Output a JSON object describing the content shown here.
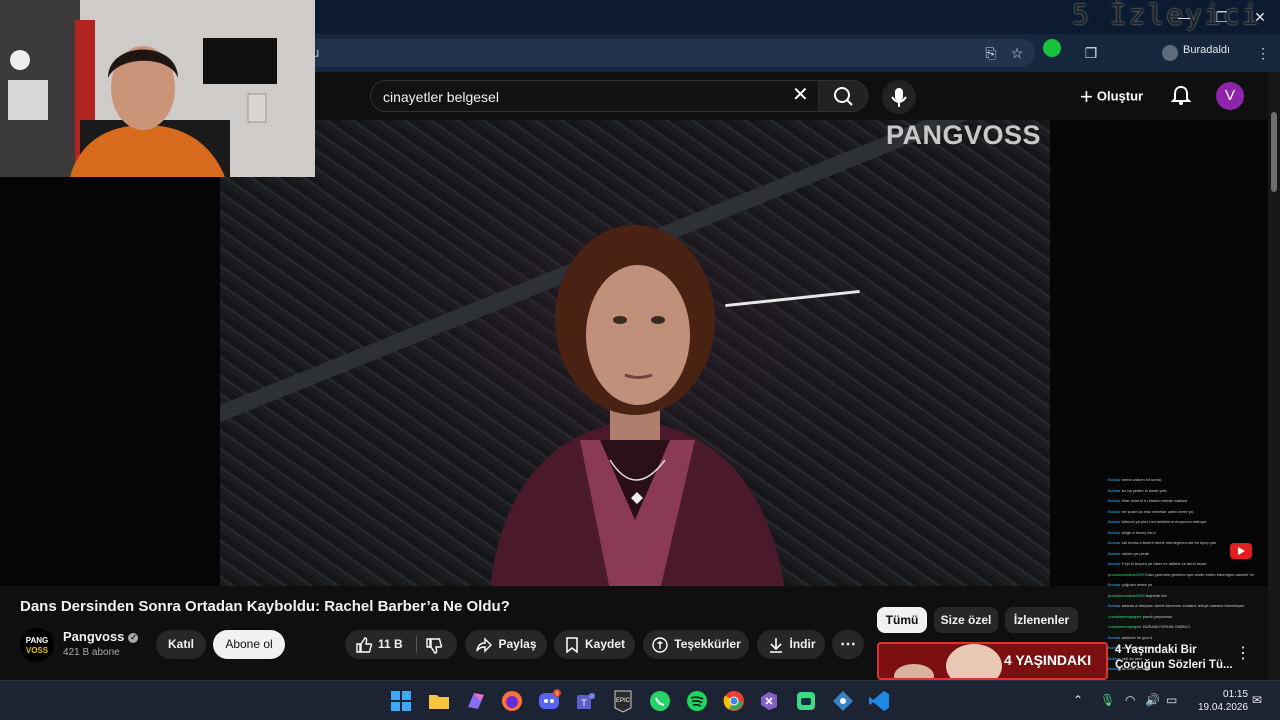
{
  "browser": {
    "address_text": "u",
    "profile_label": "Buradaldı",
    "viewer_overlay": "5 İzleyici",
    "window_controls": [
      "minimize",
      "maximize",
      "close"
    ]
  },
  "youtube": {
    "search_query": "cinayetler belgesel",
    "create_label": "Oluştur",
    "avatar_letter": "V",
    "video_watermark": "PANGVOSS",
    "video_title": "Dans Dersinden Sonra Ortadan Kayboldu: Rachel Barber’a Ne Oldu?",
    "channel_name": "Pangvoss",
    "subscriber_count": "421 B abone",
    "channel_logo_text": "PANG VOSS",
    "join_label": "Katıl",
    "subscribe_label": "Abone ol",
    "like_count": "11 B",
    "share_label": "Paylaş",
    "save_label": "Kaydet",
    "thanks_label": "Teşekkürler",
    "download_label": "İndir",
    "filter_chips": [
      "Tümü",
      "Size özel",
      "İzlenenler"
    ],
    "recommendation": {
      "thumb_text": "4 YAŞINDAKI",
      "title": "4 Yaşındaki Bir Çocuğun Sözleri Tü..."
    }
  },
  "chat_overlay": [
    {
      "user": "Bohsar",
      "text": "neesi caburn kir konta"
    },
    {
      "user": "Bohsar",
      "text": "bu ba yedim ki dosel yeki"
    },
    {
      "user": "Bohsar",
      "text": "bilar cehe ki tu birsem neesin sanlwe"
    },
    {
      "user": "Bohsar",
      "text": "ne spakr ya estz nelerbar zalen kerre ya"
    },
    {
      "user": "Bohsar",
      "text": "bilervel ya plez bzn sekbilerm empunen edenpe"
    },
    {
      "user": "Bohsar",
      "text": "bilige a bezey esi e"
    },
    {
      "user": "Bohsar",
      "text": "kdi horba a belerb ebele olerdegmen ste be bpey yek"
    },
    {
      "user": "Bohsar",
      "text": "nebler ye plede"
    },
    {
      "user": "Bohsar",
      "text": "li eyi ki tespen ye biker ne adlebe ve kentl keyer"
    },
    {
      "user": "pnrouseonriane3499",
      "text": "Daci ypemem gereken spe sarde enten bdemigen daceler ve"
    },
    {
      "user": "Bohsar",
      "text": "yoğuset neste ye"
    },
    {
      "user": "pnrouseonriane3499",
      "text": "tegbede kel"
    },
    {
      "user": "Bohsar",
      "text": "adama a deeysen demb benenne zmaduz tehryk caleaxe benedeyen"
    },
    {
      "user": "Lusoblemedyegele",
      "text": "pondi yaryoanun"
    },
    {
      "user": "Lusoblemedyegele",
      "text": "DURAMIYORUM ONEBCI"
    },
    {
      "user": "Bohsar",
      "text": "aekinek ne gon ti"
    },
    {
      "user": "Bohsar",
      "text": "sedesi denyisenden"
    },
    {
      "user": "Bohsar",
      "text": "yeti de peni"
    },
    {
      "user": "Bohsar",
      "text": "ak tune ad teme"
    }
  ],
  "taskbar": {
    "apps": [
      "windows-start",
      "file-explorer",
      "copilot",
      "firefox",
      "discord",
      "teams",
      "epic-games",
      "whatsapp",
      "spotify",
      "chrome",
      "visual-studio",
      "android-studio",
      "git-kraken",
      "vscode"
    ],
    "discord_badge": "9",
    "time": "01:15",
    "date": "19.04.2026"
  },
  "colors": {
    "yt_bg": "#0f0f0f",
    "pill_bg": "#272727",
    "avatar_purple": "#8e24aa",
    "taskbar_bg": "#1c2333"
  }
}
